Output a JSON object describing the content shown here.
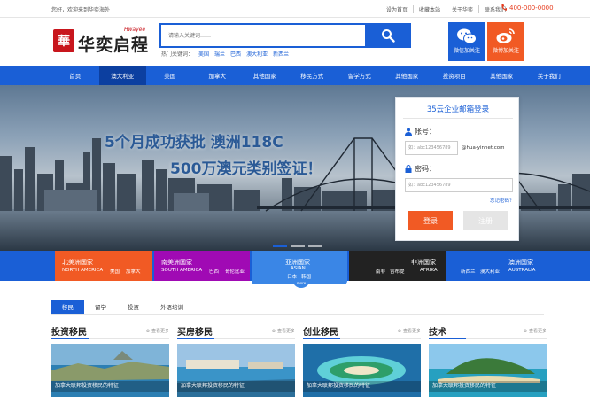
{
  "topbar": {
    "welcome": "您好，欢迎来到华奕海外",
    "links": [
      "设为首页",
      "收藏本站",
      "关于华奕",
      "联系我们"
    ],
    "phone": "400-000-0000"
  },
  "logo": {
    "name": "华奕启程",
    "english": "Hwayee",
    "seal": "華"
  },
  "search": {
    "placeholder": "请输入关键词……",
    "hot_label": "热门关键词：",
    "keywords": [
      "美国",
      "瑞兰",
      "巴西",
      "澳大利亚",
      "新西兰"
    ]
  },
  "social": {
    "wechat": "微信加关注",
    "weibo": "微博加关注"
  },
  "nav": {
    "items": [
      "首页",
      "澳大利亚",
      "美国",
      "加拿大",
      "其他国家",
      "移民方式",
      "留学方式",
      "其他国家",
      "投资项目",
      "其他国家",
      "关于我们"
    ],
    "active_index": 1
  },
  "hero": {
    "line1": "5个月成功获批 澳洲118C",
    "line2": "500万澳元类别签证！"
  },
  "login": {
    "title": "35云企业邮箱登录",
    "account_label": "帐号：",
    "account_placeholder": "如：abc123456789",
    "domain_suffix": "@hua-yinnet.com",
    "password_label": "密码：",
    "password_placeholder": "如：abc123456789",
    "forgot": "忘记密码？",
    "login_button": "登录",
    "register_button": "注册"
  },
  "regions": [
    {
      "cn": "北美洲国家",
      "en": "NORTH AMERICA",
      "countries": [
        "美国",
        "加拿大"
      ],
      "color": "#f15a24"
    },
    {
      "cn": "南美洲国家",
      "en": "SOUTH AMERICA",
      "countries": [
        "巴西",
        "哥伦比亚"
      ],
      "color": "#a00ab4"
    },
    {
      "cn": "亚洲国家",
      "en": "ASIAN",
      "countries": [
        "日本",
        "韩国"
      ],
      "color": "#3a86e6"
    },
    {
      "cn": "非洲国家",
      "en": "AFRIKA",
      "countries": [
        "南非",
        "吉布提"
      ],
      "color": "#222222"
    },
    {
      "cn": "澳洲国家",
      "en": "AUSTRALIA",
      "countries": [
        "新西兰",
        "澳大利亚"
      ],
      "color": "#1a5fd6"
    }
  ],
  "asia_badge": "more",
  "tabs": {
    "items": [
      "移民",
      "留学",
      "投资",
      "外语培训"
    ],
    "active_index": 0
  },
  "sections": [
    {
      "title": "投资移民",
      "more": "查看更多",
      "caption": "加拿大联邦投资移民的特征"
    },
    {
      "title": "买房移民",
      "more": "查看更多",
      "caption": "加拿大联邦投资移民的特征"
    },
    {
      "title": "创业移民",
      "more": "查看更多",
      "caption": "加拿大联邦投资移民的特征"
    },
    {
      "title": "技术",
      "more": "查看更多",
      "caption": "加拿大联邦投资移民的特征"
    }
  ],
  "colors": {
    "brand_blue": "#1a5fd6",
    "accent_orange": "#f15a24",
    "logo_red": "#c8161d"
  }
}
